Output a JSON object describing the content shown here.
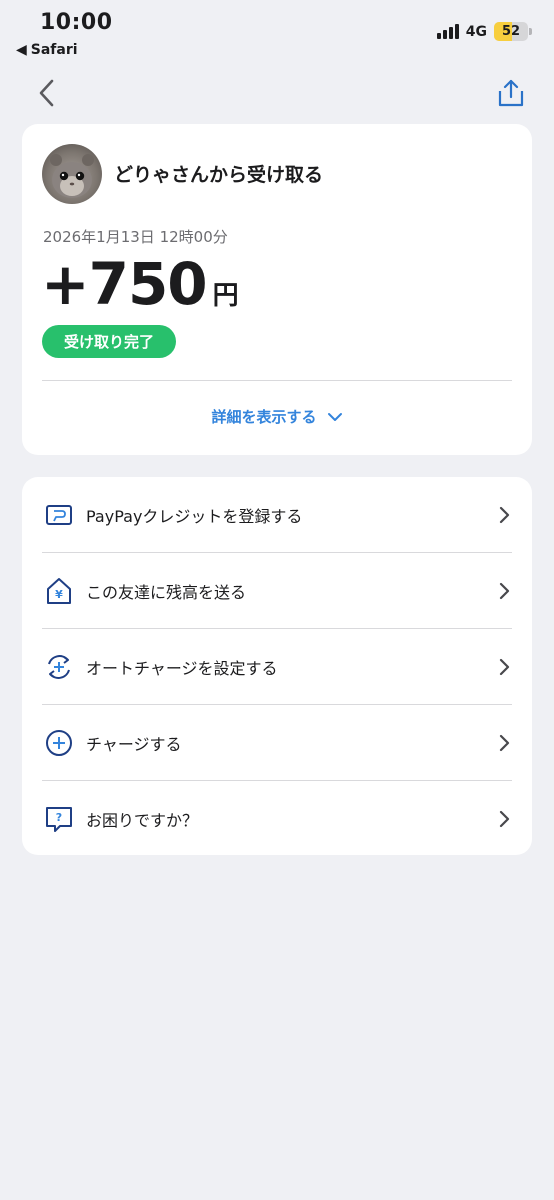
{
  "status_bar": {
    "time": "10:00",
    "back_app": "Safari",
    "network": "4G",
    "battery": "52",
    "battery_level": 0.52,
    "battery_color": "#f7ce3e"
  },
  "nav": {
    "back_icon": "chevron-left-icon",
    "share_icon": "share-icon"
  },
  "transaction": {
    "title": "どりゃさんから受け取る",
    "date": "2026年1月13日 12時00分",
    "amount": "+750",
    "currency": "円",
    "status": "受け取り完了",
    "status_color": "#28c06c",
    "details_label": "詳細を表示する"
  },
  "menu": {
    "items": [
      {
        "label": "PayPayクレジットを登録する",
        "icon": "credit-card-icon"
      },
      {
        "label": "この友達に残高を送る",
        "icon": "yen-house-icon"
      },
      {
        "label": "オートチャージを設定する",
        "icon": "auto-charge-icon"
      },
      {
        "label": "チャージする",
        "icon": "plus-circle-icon"
      },
      {
        "label": "お困りですか？",
        "icon": "help-bubble-icon"
      }
    ]
  },
  "colors": {
    "accent": "#3384dc",
    "icon_navy": "#1f3f85",
    "background": "#eff0f4"
  }
}
